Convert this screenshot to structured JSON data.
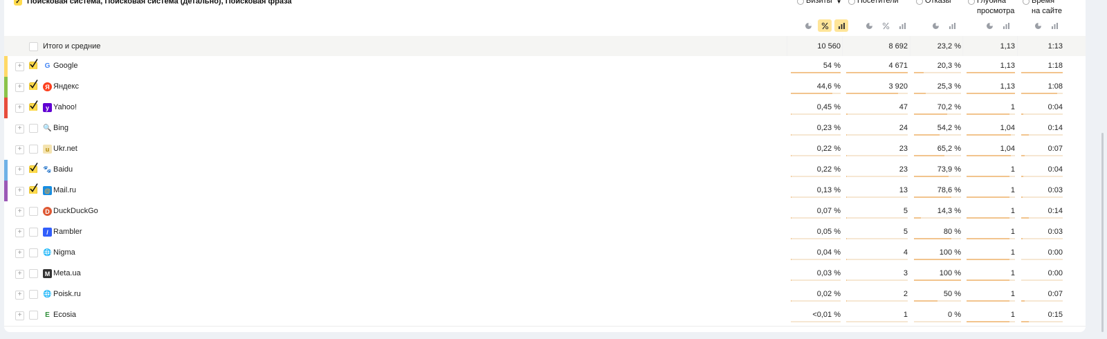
{
  "dimensions_header": "Поисковая система, Поисковая система (детально), Поисковая фраза",
  "metrics": [
    {
      "label_lines": [
        "Визиты"
      ],
      "has_caret": true
    },
    {
      "label_lines": [
        "Посетители"
      ]
    },
    {
      "label_lines": [
        "Отказы"
      ]
    },
    {
      "label_lines": [
        "Глубина",
        "просмотра"
      ]
    },
    {
      "label_lines": [
        "Время",
        "на сайте"
      ]
    }
  ],
  "totals": {
    "label": "Итого и средние",
    "values": [
      "10 560",
      "8 692",
      "23,2 %",
      "1,13",
      "1:13"
    ]
  },
  "rows": [
    {
      "name": "Google",
      "checked": true,
      "color": "#ffd966",
      "icon": "google-icon",
      "values": [
        "54 %",
        "4 671",
        "20,3 %",
        "1,13",
        "1:18"
      ],
      "bars": [
        1.0,
        1.0,
        0.2,
        1.0,
        1.0
      ]
    },
    {
      "name": "Яндекс",
      "checked": true,
      "color": "#8bc34a",
      "icon": "yandex-icon",
      "values": [
        "44,6 %",
        "3 920",
        "25,3 %",
        "1,13",
        "1:08"
      ],
      "bars": [
        0.83,
        0.84,
        0.25,
        1.0,
        0.87
      ]
    },
    {
      "name": "Yahoo!",
      "checked": true,
      "color": "#e74c3c",
      "icon": "yahoo-icon",
      "values": [
        "0,45 %",
        "47",
        "70,2 %",
        "1",
        "0:04"
      ],
      "bars": [
        0.02,
        0.02,
        0.7,
        0.88,
        0.05
      ]
    },
    {
      "name": "Bing",
      "checked": false,
      "color": "",
      "icon": "bing-icon",
      "values": [
        "0,23 %",
        "24",
        "54,2 %",
        "1,04",
        "0:14"
      ],
      "bars": [
        0.01,
        0.01,
        0.54,
        0.92,
        0.18
      ]
    },
    {
      "name": "Ukr.net",
      "checked": false,
      "color": "",
      "icon": "ukrnet-icon",
      "values": [
        "0,22 %",
        "23",
        "65,2 %",
        "1,04",
        "0:07"
      ],
      "bars": [
        0.01,
        0.01,
        0.65,
        0.92,
        0.09
      ]
    },
    {
      "name": "Baidu",
      "checked": true,
      "color": "#6fb1e6",
      "icon": "baidu-icon",
      "values": [
        "0,22 %",
        "23",
        "73,9 %",
        "1",
        "0:04"
      ],
      "bars": [
        0.01,
        0.01,
        0.74,
        0.88,
        0.05
      ]
    },
    {
      "name": "Mail.ru",
      "checked": true,
      "color": "#9b59b6",
      "icon": "mailru-icon",
      "values": [
        "0,13 %",
        "13",
        "78,6 %",
        "1",
        "0:03"
      ],
      "bars": [
        0.01,
        0.01,
        0.79,
        0.88,
        0.04
      ]
    },
    {
      "name": "DuckDuckGo",
      "checked": false,
      "color": "",
      "icon": "duckduckgo-icon",
      "values": [
        "0,07 %",
        "5",
        "14,3 %",
        "1",
        "0:14"
      ],
      "bars": [
        0.01,
        0.01,
        0.14,
        0.88,
        0.18
      ]
    },
    {
      "name": "Rambler",
      "checked": false,
      "color": "",
      "icon": "rambler-icon",
      "values": [
        "0,05 %",
        "5",
        "80 %",
        "1",
        "0:03"
      ],
      "bars": [
        0.01,
        0.01,
        0.8,
        0.88,
        0.04
      ]
    },
    {
      "name": "Nigma",
      "checked": false,
      "color": "",
      "icon": "globe-icon",
      "values": [
        "0,04 %",
        "4",
        "100 %",
        "1",
        "0:00"
      ],
      "bars": [
        0.01,
        0.01,
        1.0,
        0.88,
        0.0
      ]
    },
    {
      "name": "Meta.ua",
      "checked": false,
      "color": "",
      "icon": "metaua-icon",
      "values": [
        "0,03 %",
        "3",
        "100 %",
        "1",
        "0:00"
      ],
      "bars": [
        0.01,
        0.01,
        1.0,
        0.88,
        0.0
      ]
    },
    {
      "name": "Poisk.ru",
      "checked": false,
      "color": "",
      "icon": "globe-icon",
      "values": [
        "0,02 %",
        "2",
        "50 %",
        "1",
        "0:07"
      ],
      "bars": [
        0.01,
        0.01,
        0.5,
        0.88,
        0.09
      ]
    },
    {
      "name": "Ecosia",
      "checked": false,
      "color": "",
      "icon": "ecosia-icon",
      "values": [
        "<0,01 %",
        "1",
        "0 %",
        "1",
        "0:15"
      ],
      "bars": [
        0.0,
        0.0,
        0.0,
        0.88,
        0.19
      ]
    }
  ]
}
